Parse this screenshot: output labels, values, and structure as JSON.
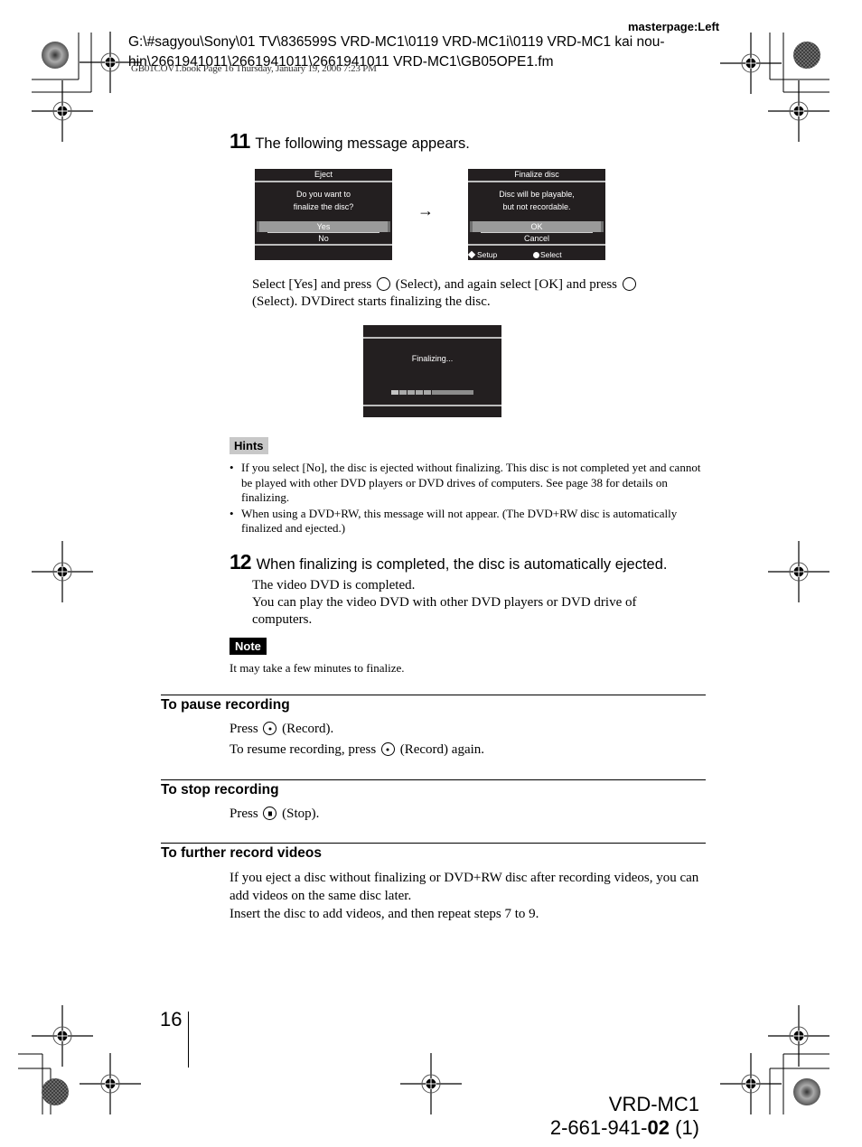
{
  "header": {
    "masterpage": "masterpage:Left",
    "file_path": "G:\\#sagyou\\Sony\\01 TV\\836599S VRD-MC1\\0119 VRD-MC1i\\0119 VRD-MC1 kai nou-hin\\2661941011\\2661941011\\2661941011 VRD-MC1\\GB05OPE1.fm",
    "book_info": "GB01COV1.book  Page 16  Thursday, January 19, 2006  7:23 PM"
  },
  "step11": {
    "number": "11",
    "heading": "The following message appears.",
    "screen_eject": {
      "title": "Eject",
      "message_line1": "Do you want to",
      "message_line2": "finalize the disc?",
      "option_selected": "Yes",
      "option_other": "No"
    },
    "arrow": "→",
    "screen_finalize": {
      "title": "Finalize disc",
      "message_line1": "Disc will be playable,",
      "message_line2": "but not recordable.",
      "option_selected": "OK",
      "option_other": "Cancel",
      "footer_left": "Setup",
      "footer_right": "Select"
    },
    "instruction_part1": "Select [Yes] and press",
    "instruction_part2": "(Select), and again select [OK] and press",
    "instruction_part3": "(Select). DVDirect starts finalizing the disc.",
    "screen_progress": {
      "message": "Finalizing...",
      "segments_filled": 5,
      "progress_fraction": 0.4
    },
    "hints_label": "Hints",
    "hints": [
      "If you select [No], the disc is ejected without finalizing. This disc is not completed yet and cannot be played with other DVD players or DVD drives of computers. See page 38 for details on finalizing.",
      "When using a DVD+RW, this message will not appear. (The DVD+RW disc is automatically finalized and ejected.)"
    ]
  },
  "step12": {
    "number": "12",
    "heading": "When finalizing is completed, the disc is automatically ejected.",
    "line1": "The video DVD is completed.",
    "line2": "You can play the video DVD with other DVD players or DVD drive of computers.",
    "note_label": "Note",
    "note": "It may take a few minutes to finalize."
  },
  "sections": {
    "pause": {
      "title": "To pause recording",
      "line1_a": "Press",
      "line1_b": "(Record).",
      "line2_a": "To resume recording, press",
      "line2_b": "(Record) again."
    },
    "stop": {
      "title": "To stop recording",
      "line1_a": "Press",
      "line1_b": "(Stop)."
    },
    "further": {
      "title": "To further record videos",
      "line1": "If you eject a disc without finalizing or DVD+RW disc after recording videos, you can add videos on the same disc later.",
      "line2": "Insert the disc to add videos, and then repeat steps 7 to 9."
    }
  },
  "footer": {
    "page_number": "16",
    "model": "VRD-MC1",
    "part_prefix": "2-661-941-",
    "part_bold": "02",
    "part_suffix": " (1)"
  }
}
